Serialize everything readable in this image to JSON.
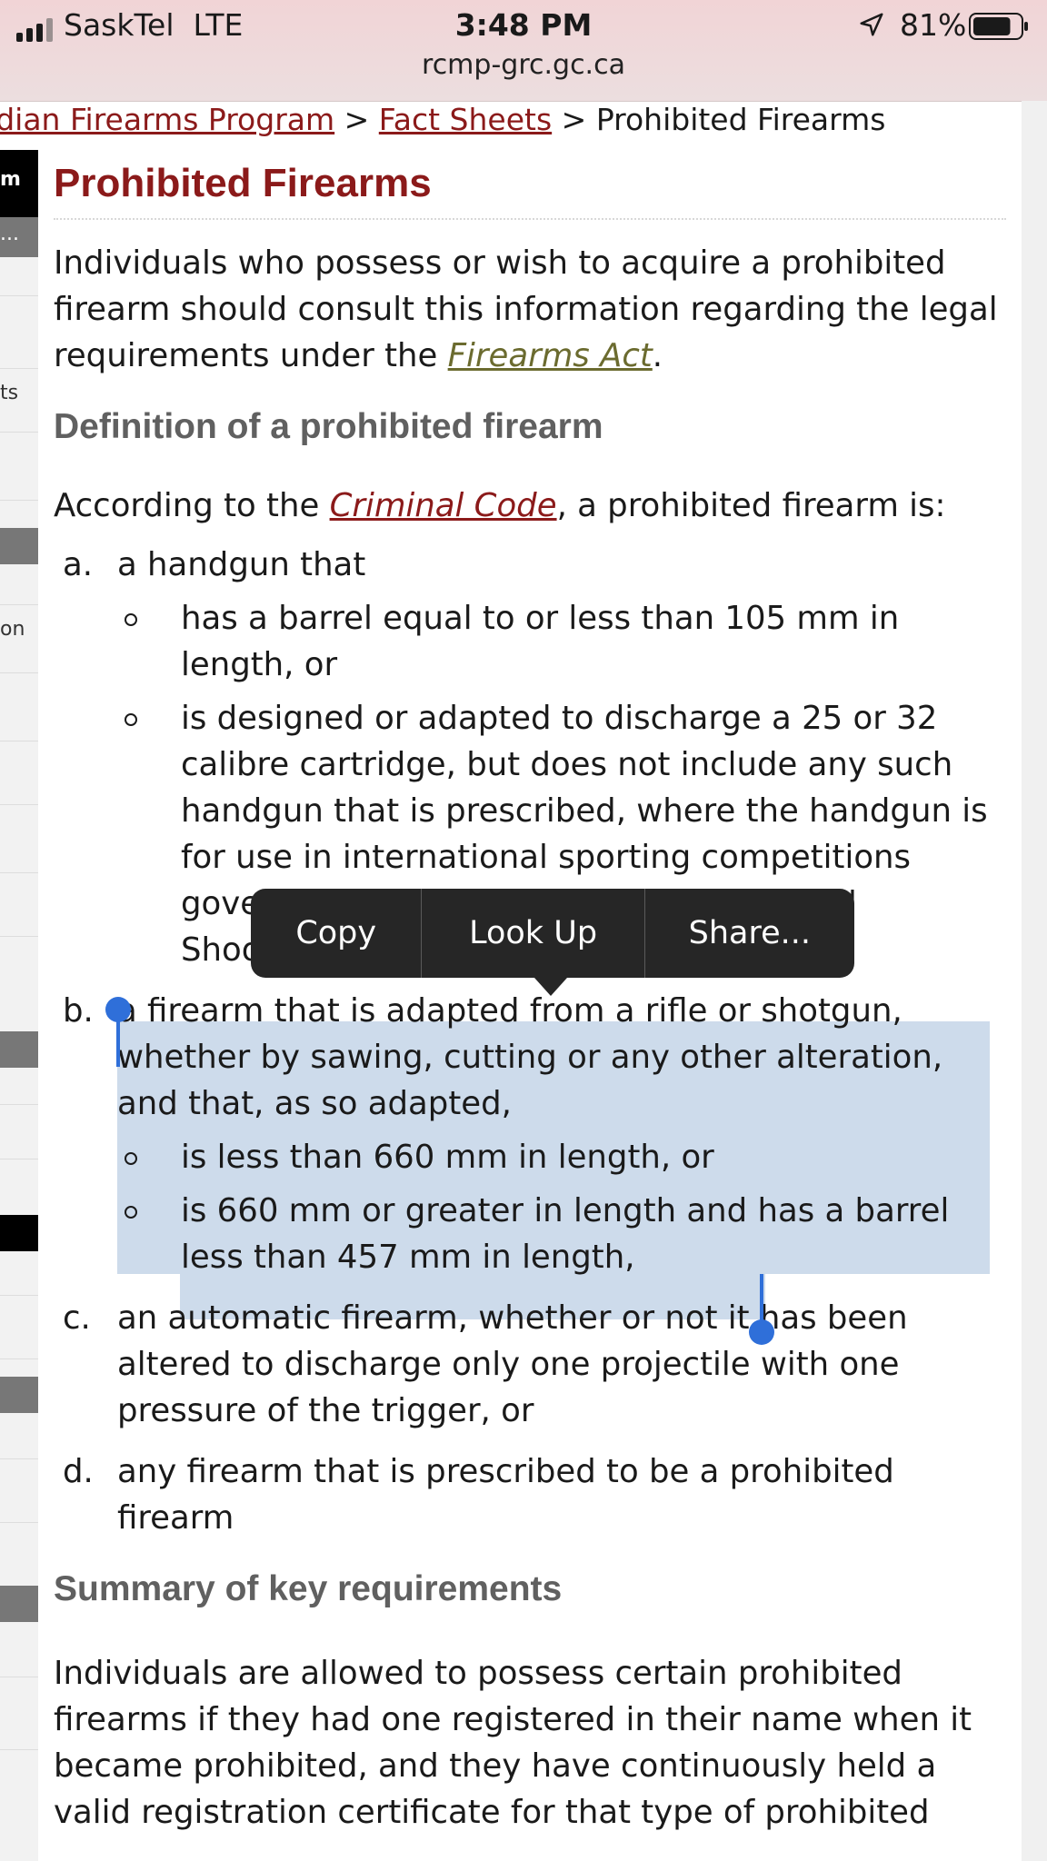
{
  "status_bar": {
    "carrier": "SaskTel",
    "network": "LTE",
    "time": "3:48 PM",
    "battery_percent": "81%",
    "battery_level": 0.81,
    "signal_bars": 3,
    "icons": [
      "signal-icon",
      "location-arrow-icon",
      "battery-icon"
    ]
  },
  "browser": {
    "url": "rcmp-grc.gc.ca"
  },
  "breadcrumb": {
    "items": [
      {
        "label": "adian Firearms Program",
        "link": true
      },
      {
        "label": "Fact Sheets",
        "link": true
      },
      {
        "label": "Prohibited Firearms",
        "link": false
      }
    ],
    "separator": ">"
  },
  "sidebar": {
    "fragments": [
      "m",
      "...",
      "ts",
      "on"
    ]
  },
  "page": {
    "title": "Prohibited Firearms",
    "intro": {
      "before": "Individuals who possess or wish to acquire a prohibited firearm should consult this information regarding the legal requirements under the ",
      "link": "Firearms Act",
      "after": "."
    },
    "definition_heading": "Definition of a prohibited firearm",
    "according": {
      "before": "According to the ",
      "link": "Criminal Code",
      "after": ", a prohibited firearm is:"
    },
    "items": [
      {
        "marker": "a.",
        "text": "a handgun that",
        "sub": [
          "has a barrel equal to or less than 105 mm in length, or",
          "is designed or adapted to discharge a 25 or 32 calibre cartridge, but does not include any such handgun that is prescribed, where the handgun is for use in international sporting competitions governed by the rules of the International Shooting Union,"
        ]
      },
      {
        "marker": "b.",
        "text": "a firearm that is adapted from a rifle or shotgun, whether by sawing, cutting or any other alteration, and that, as so adapted,",
        "sub": [
          "is less than 660 mm in length, or",
          "is 660 mm or greater in length and has a barrel less than 457 mm in length,"
        ]
      },
      {
        "marker": "c.",
        "text": "an automatic firearm, whether or not it has been altered to discharge only one projectile with one pressure of the trigger, or"
      },
      {
        "marker": "d.",
        "text": "any firearm that is prescribed to be a prohibited firearm"
      }
    ],
    "summary_heading": "Summary of key requirements",
    "summary_text": "Individuals are allowed to possess certain prohibited firearms if they had one registered in their name when it became prohibited, and they have continuously held a valid registration certificate for that type of prohibited"
  },
  "context_menu": {
    "copy": "Copy",
    "look_up": "Look Up",
    "share": "Share..."
  },
  "colors": {
    "link_red": "#8b1a1a",
    "link_olive": "#6b6b2f",
    "heading_gray": "#606060",
    "selection": "#cddbeb",
    "selection_handle": "#2f6fd9",
    "menu_bg": "#262626",
    "status_bg": "#f1d4d6"
  }
}
